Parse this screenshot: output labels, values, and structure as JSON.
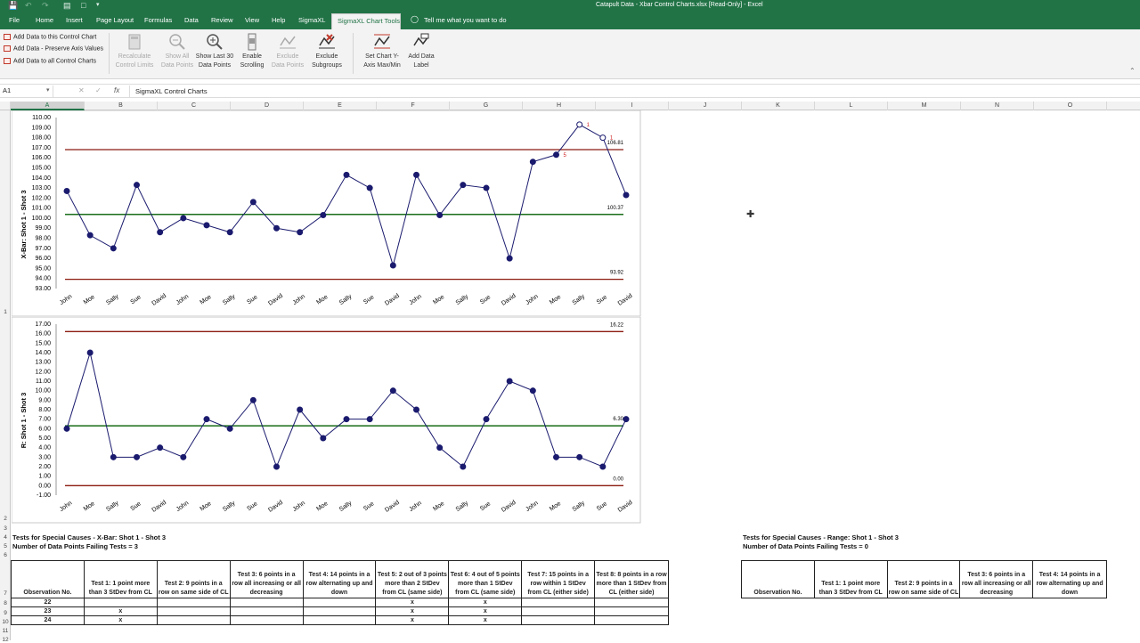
{
  "window": {
    "title": "Catapult Data - Xbar Control Charts.xlsx  [Read-Only]  -  Excel"
  },
  "menu": {
    "tabs": [
      "File",
      "Home",
      "Insert",
      "Page Layout",
      "Formulas",
      "Data",
      "Review",
      "View",
      "Help",
      "SigmaXL",
      "SigmaXL Chart Tools"
    ],
    "tell_me": "Tell me what you want to do"
  },
  "ribbon": {
    "add_data_this": "Add Data to this Control Chart",
    "add_data_preserve": "Add Data - Preserve Axis Values",
    "add_data_all": "Add Data to all Control Charts",
    "recalc_1": "Recalculate",
    "recalc_2": "Control Limits",
    "showall_1": "Show All",
    "showall_2": "Data Points",
    "last30_1": "Show Last 30",
    "last30_2": "Data Points",
    "scroll_1": "Enable",
    "scroll_2": "Scrolling",
    "exclpts_1": "Exclude",
    "exclpts_2": "Data Points",
    "exclsub_1": "Exclude",
    "exclsub_2": "Subgroups",
    "setaxis_1": "Set Chart Y-",
    "setaxis_2": "Axis Max/Min",
    "addlabel_1": "Add Data",
    "addlabel_2": "Label"
  },
  "formula_bar": {
    "cell": "A1",
    "fx": "fx",
    "content": "SigmaXL Control Charts"
  },
  "columns": [
    "A",
    "B",
    "C",
    "D",
    "E",
    "F",
    "G",
    "H",
    "I",
    "J",
    "K",
    "L",
    "M",
    "N",
    "O"
  ],
  "rows": [
    "1",
    "2",
    "3",
    "4",
    "5",
    "6",
    "7",
    "8",
    "9",
    "10",
    "11",
    "12"
  ],
  "chart_data": [
    {
      "type": "line",
      "ylabel": "X-Bar: Shot 1 - Shot 3",
      "ylim": [
        93,
        110
      ],
      "ytick_labels": [
        "93.00",
        "94.00",
        "95.00",
        "96.00",
        "97.00",
        "98.00",
        "99.00",
        "100.00",
        "101.00",
        "102.00",
        "103.00",
        "104.00",
        "105.00",
        "106.00",
        "107.00",
        "108.00",
        "109.00",
        "110.00"
      ],
      "categories": [
        "John",
        "Moe",
        "Sally",
        "Sue",
        "David",
        "John",
        "Moe",
        "Sally",
        "Sue",
        "David",
        "John",
        "Moe",
        "Sally",
        "Sue",
        "David",
        "John",
        "Moe",
        "Sally",
        "Sue",
        "David",
        "John",
        "Moe",
        "Sally",
        "Sue",
        "David"
      ],
      "values": [
        102.7,
        98.3,
        97.0,
        103.3,
        98.6,
        100.0,
        99.3,
        98.6,
        101.6,
        99.0,
        98.6,
        100.3,
        104.3,
        103.0,
        95.3,
        104.3,
        100.3,
        103.3,
        103.0,
        96.0,
        105.6,
        106.3,
        109.3,
        108.0,
        102.3
      ],
      "ucl": 106.81,
      "cl": 100.37,
      "lcl": 93.92,
      "ucl_label": "106.81",
      "cl_label": "100.37",
      "lcl_label": "93.92",
      "flags": [
        {
          "index": 21,
          "label": "5"
        },
        {
          "index": 22,
          "label": "1"
        },
        {
          "index": 23,
          "label": "1"
        }
      ],
      "colors": {
        "line": "#1a1a6e",
        "ucl": "#8b1a10",
        "cl": "#1a6e1a",
        "flag": "#d02020"
      }
    },
    {
      "type": "line",
      "ylabel": "R: Shot 1 - Shot 3",
      "ylim": [
        -1,
        17
      ],
      "ytick_labels": [
        "-1.00",
        "0.00",
        "1.00",
        "2.00",
        "3.00",
        "4.00",
        "5.00",
        "6.00",
        "7.00",
        "8.00",
        "9.00",
        "10.00",
        "11.00",
        "12.00",
        "13.00",
        "14.00",
        "15.00",
        "16.00",
        "17.00"
      ],
      "categories": [
        "John",
        "Moe",
        "Sally",
        "Sue",
        "David",
        "John",
        "Moe",
        "Sally",
        "Sue",
        "David",
        "John",
        "Moe",
        "Sally",
        "Sue",
        "David",
        "John",
        "Moe",
        "Sally",
        "Sue",
        "David",
        "John",
        "Moe",
        "Sally",
        "Sue",
        "David"
      ],
      "values": [
        6,
        14,
        3,
        3,
        4,
        3,
        7,
        6,
        9,
        2,
        8,
        5,
        7,
        7,
        10,
        8,
        4,
        2,
        7,
        11,
        10,
        3,
        3,
        2,
        7
      ],
      "ucl": 16.22,
      "cl": 6.3,
      "lcl": 0.0,
      "ucl_label": "16.22",
      "cl_label": "6.30",
      "lcl_label": "0.00",
      "colors": {
        "line": "#1a1a6e",
        "ucl": "#8b1a10",
        "cl": "#1a6e1a"
      }
    }
  ],
  "xbar_tests": {
    "title": "Tests for Special Causes - X-Bar: Shot 1 - Shot 3",
    "failing": "Number of Data Points Failing Tests = 3",
    "headers": [
      "Observation No.",
      "Test 1: 1 point more than 3 StDev from CL",
      "Test 2: 9 points in a row on same side of CL",
      "Test 3: 6 points in a row all increasing or all decreasing",
      "Test 4: 14 points in a row alternating up and down",
      "Test 5: 2 out of 3 points more than 2 StDev from CL (same side)",
      "Test 6: 4 out of 5 points more than 1 StDev from CL (same side)",
      "Test 7: 15 points in a row within 1 StDev from CL (either side)",
      "Test 8: 8 points in a row more than 1 StDev from CL (either side)"
    ],
    "rows": [
      [
        "22",
        "",
        "",
        "",
        "",
        "x",
        "x",
        "",
        ""
      ],
      [
        "23",
        "x",
        "",
        "",
        "",
        "x",
        "x",
        "",
        ""
      ],
      [
        "24",
        "x",
        "",
        "",
        "",
        "x",
        "x",
        "",
        ""
      ]
    ]
  },
  "range_tests": {
    "title": "Tests for Special Causes - Range: Shot 1 - Shot 3",
    "failing": "Number of Data Points Failing Tests = 0",
    "headers": [
      "Observation No.",
      "Test 1: 1 point more than 3 StDev from CL",
      "Test 2: 9 points in a row on same side of CL",
      "Test 3: 6 points in a row all increasing or all decreasing",
      "Test 4: 14 points in a row alternating up and down"
    ]
  }
}
